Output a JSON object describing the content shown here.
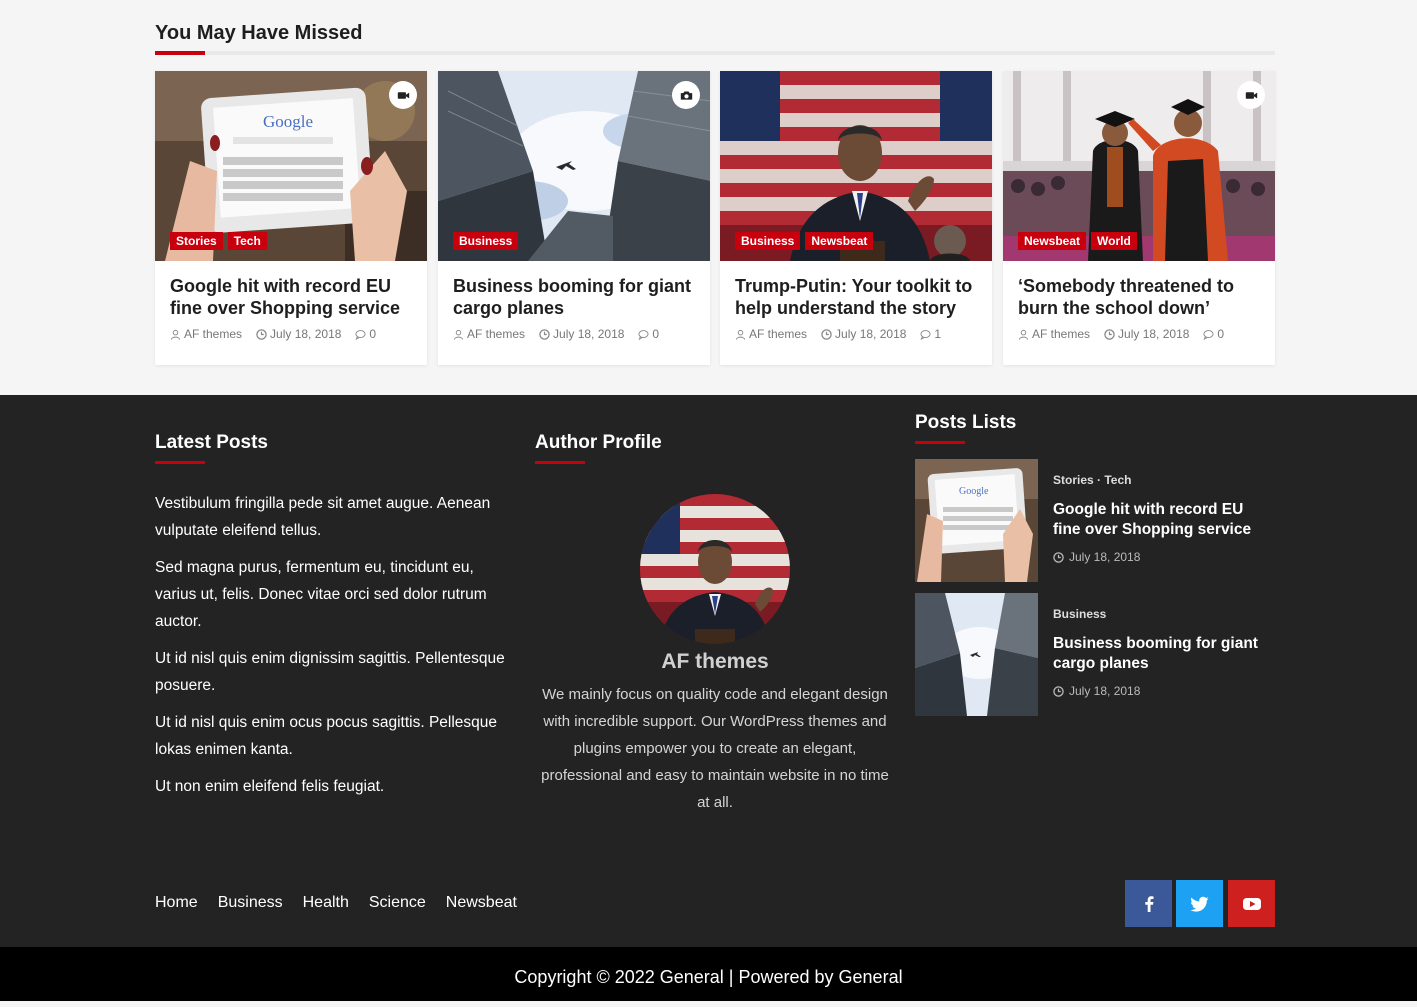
{
  "missed": {
    "title": "You May Have Missed",
    "cards": [
      {
        "format_icon": "video-icon",
        "categories": [
          "Stories",
          "Tech"
        ],
        "title": "Google hit with record EU fine over Shopping service",
        "author": "AF themes",
        "date": "July 18, 2018",
        "comments": "0"
      },
      {
        "format_icon": "camera-icon",
        "categories": [
          "Business"
        ],
        "title": "Business booming for giant cargo planes",
        "author": "AF themes",
        "date": "July 18, 2018",
        "comments": "0"
      },
      {
        "format_icon": "",
        "categories": [
          "Business",
          "Newsbeat"
        ],
        "title": "Trump-Putin: Your toolkit to help understand the story",
        "author": "AF themes",
        "date": "July 18, 2018",
        "comments": "1"
      },
      {
        "format_icon": "video-icon",
        "categories": [
          "Newsbeat",
          "World"
        ],
        "title": "‘Somebody threatened to burn the school down’",
        "author": "AF themes",
        "date": "July 18, 2018",
        "comments": "0"
      }
    ]
  },
  "footer": {
    "latest": {
      "title": "Latest Posts",
      "paragraphs": [
        "Vestibulum fringilla pede sit amet augue. Aenean vulputate eleifend tellus.",
        "Sed magna purus, fermentum eu, tincidunt eu, varius ut, felis. Donec vitae orci sed dolor rutrum auctor.",
        "Ut id nisl quis enim dignissim sagittis. Pellentesque posuere.",
        "Ut id nisl quis enim ocus pocus sagittis. Pellesque lokas enimen kanta.",
        "Ut non enim eleifend felis feugiat."
      ]
    },
    "author": {
      "title": "Author Profile",
      "name": "AF themes",
      "bio": "We mainly focus on quality code and elegant design with incredible support. Our WordPress themes and plugins empower you to create an elegant, professional and easy to maintain website in no time at all."
    },
    "posts": {
      "title": "Posts Lists",
      "items": [
        {
          "categories": "Stories · Tech",
          "title": "Google hit with record EU fine over Shopping service",
          "date": "July 18, 2018"
        },
        {
          "categories": "Business",
          "title": "Business booming for giant cargo planes",
          "date": "July 18, 2018"
        }
      ]
    },
    "nav": [
      "Home",
      "Business",
      "Health",
      "Science",
      "Newsbeat"
    ],
    "social": [
      {
        "icon": "facebook-icon",
        "color": "#3b5998"
      },
      {
        "icon": "twitter-icon",
        "color": "#1da1f2"
      },
      {
        "icon": "youtube-icon",
        "color": "#cd201f"
      }
    ],
    "copyright": "Copyright © 2022 General | Powered by General"
  },
  "colors": {
    "accent": "#c8000e",
    "footer_bg": "#232323",
    "page_bg": "#f5f5f5"
  }
}
